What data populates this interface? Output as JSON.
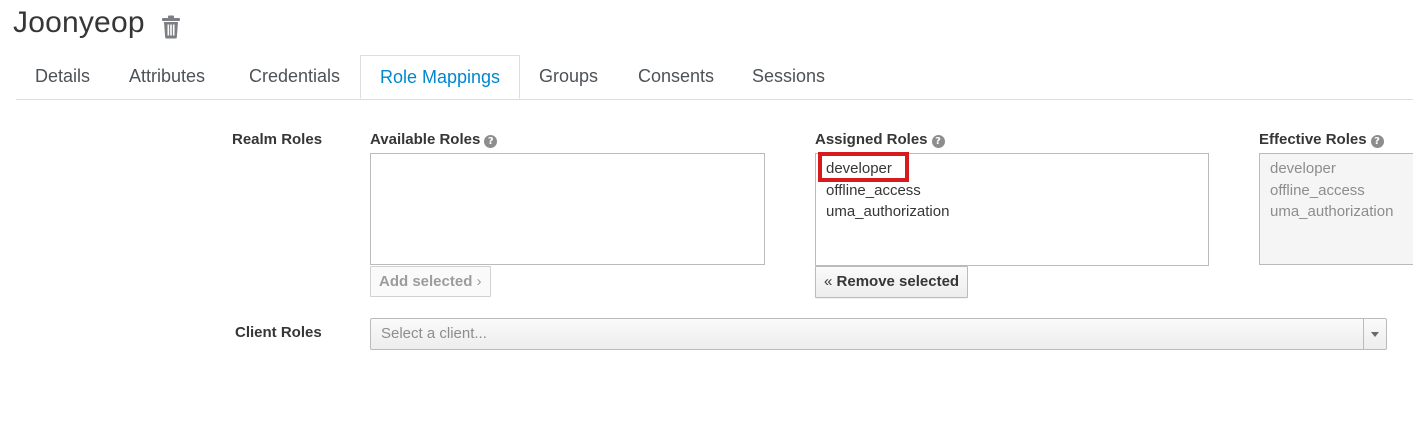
{
  "header": {
    "title": "Joonyeop",
    "delete_icon": "trash-icon"
  },
  "tabs": [
    {
      "label": "Details"
    },
    {
      "label": "Attributes"
    },
    {
      "label": "Credentials"
    },
    {
      "label": "Role Mappings",
      "active": true
    },
    {
      "label": "Groups"
    },
    {
      "label": "Consents"
    },
    {
      "label": "Sessions"
    }
  ],
  "realm_roles": {
    "label": "Realm Roles",
    "available": {
      "label": "Available Roles",
      "help_icon": "question-circle-icon",
      "items": [],
      "button": "Add selected"
    },
    "assigned": {
      "label": "Assigned Roles",
      "help_icon": "question-circle-icon",
      "items": [
        "developer",
        "offline_access",
        "uma_authorization"
      ],
      "highlighted": "developer",
      "button": "Remove selected"
    },
    "effective": {
      "label": "Effective Roles",
      "help_icon": "question-circle-icon",
      "items": [
        "developer",
        "offline_access",
        "uma_authorization"
      ]
    }
  },
  "client_roles": {
    "label": "Client Roles",
    "select_placeholder": "Select a client..."
  },
  "colors": {
    "active_tab": "#0088ce",
    "highlight_border": "#d71920"
  }
}
